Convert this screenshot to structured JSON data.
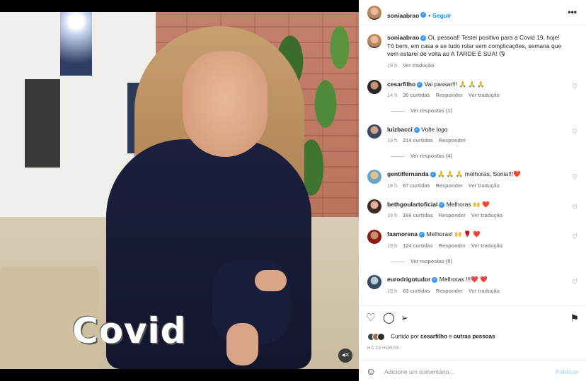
{
  "media": {
    "caption_overlay": "Covid",
    "mute_icon": "speaker-muted-icon"
  },
  "header": {
    "username": "soniaabrao",
    "separator": "•",
    "follow_label": "Seguir",
    "more_icon": "more-options-icon"
  },
  "caption": {
    "username": "soniaabrao",
    "text": "Oi, pessoal! Testei positivo para a Covid 19, hoje! Tô bem, em casa e se tudo rolar sem complicações, semana que vem estarei de volta ao A TARDE É SUA! 😘",
    "time": "19 h",
    "translate": "Ver tradução"
  },
  "comments": [
    {
      "username": "cesarfilho",
      "text": "Vai passar!!! 🙏 🙏 🙏",
      "time": "14 h",
      "likes": "30 curtidas",
      "reply": "Responder",
      "translate": "Ver tradução",
      "view_replies": "Ver respostas (1)"
    },
    {
      "username": "luizbacci",
      "text": "Volte logo",
      "time": "19 h",
      "likes": "214 curtidas",
      "reply": "Responder",
      "translate": "",
      "view_replies": "Ver respostas (4)"
    },
    {
      "username": "gentilfernanda",
      "text": "🙏 🙏 🙏 melhoras, Sonia!!!❤️",
      "time": "18 h",
      "likes": "87 curtidas",
      "reply": "Responder",
      "translate": "Ver tradução",
      "view_replies": ""
    },
    {
      "username": "bethgoulartoficial",
      "text": "Melhoras 🙌 ❤️",
      "time": "19 h",
      "likes": "166 curtidas",
      "reply": "Responder",
      "translate": "Ver tradução",
      "view_replies": ""
    },
    {
      "username": "faamorena",
      "text": "Melhoras! 🙌 🌹 ❤️",
      "time": "19 h",
      "likes": "124 curtidas",
      "reply": "Responder",
      "translate": "Ver tradução",
      "view_replies": "Ver respostas (8)"
    },
    {
      "username": "eurodrigotudor",
      "text": "Melhoras !!!❤️ ❤️",
      "time": "19 h",
      "likes": "63 curtidas",
      "reply": "Responder",
      "translate": "Ver tradução",
      "view_replies": ""
    }
  ],
  "actions": {
    "like_icon": "heart-icon",
    "comment_icon": "comment-icon",
    "share_icon": "send-icon",
    "save_icon": "bookmark-icon",
    "liked_by_prefix": "Curtido por",
    "liked_by_user": "cesarfilho",
    "liked_by_and": "e",
    "liked_by_others": "outras pessoas",
    "time_ago": "HÁ 19 HORAS"
  },
  "comment_box": {
    "emoji_icon": "smiley-icon",
    "placeholder": "Adicione um comentário...",
    "publish_label": "Publicar"
  },
  "colors": {
    "accent": "#0095f6",
    "verified": "#3897f0",
    "muted_text": "#8e8e8e",
    "publish_disabled": "#b3dbff"
  }
}
